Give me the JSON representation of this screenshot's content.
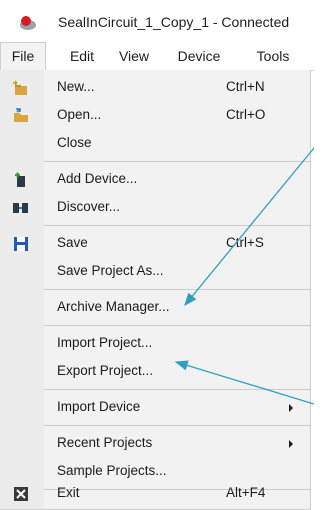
{
  "window": {
    "title": "SealInCircuit_1_Copy_1 - Connected"
  },
  "menubar": {
    "items": [
      "File",
      "Edit",
      "View",
      "Device",
      "Tools"
    ]
  },
  "file_menu": {
    "items": [
      {
        "label": "New...",
        "shortcut": "Ctrl+N",
        "icon": "new-file-icon"
      },
      {
        "label": "Open...",
        "shortcut": "Ctrl+O",
        "icon": "open-folder-icon"
      },
      {
        "label": "Close",
        "shortcut": ""
      },
      {
        "label": "Add Device...",
        "shortcut": "",
        "icon": "add-device-icon"
      },
      {
        "label": "Discover...",
        "shortcut": "",
        "icon": "discover-icon"
      },
      {
        "label": "Save",
        "shortcut": "Ctrl+S",
        "icon": "save-icon"
      },
      {
        "label": "Save Project As...",
        "shortcut": ""
      },
      {
        "label": "Archive Manager...",
        "shortcut": ""
      },
      {
        "label": "Import Project...",
        "shortcut": ""
      },
      {
        "label": "Export Project...",
        "shortcut": ""
      },
      {
        "label": "Import Device",
        "shortcut": "",
        "submenu": true
      },
      {
        "label": "Recent Projects",
        "shortcut": "",
        "submenu": true
      },
      {
        "label": "Sample Projects...",
        "shortcut": ""
      },
      {
        "label": "Exit",
        "shortcut": "Alt+F4",
        "icon": "exit-icon"
      }
    ]
  },
  "colors": {
    "menu_background": "#f2f2f2",
    "annotation_arrow": "#2f9fc0"
  }
}
